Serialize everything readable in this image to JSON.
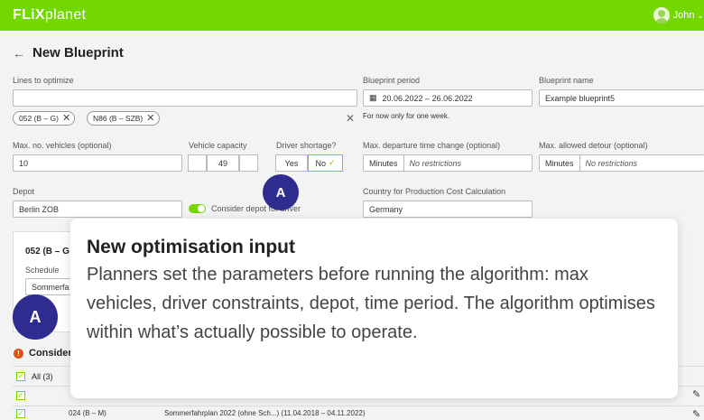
{
  "header": {
    "brand_bold": "FLiX",
    "brand_light": "planet",
    "user_name": "John",
    "colors": {
      "brand": "#73d700",
      "badge": "#2e2c8e",
      "warning": "#e2520e"
    }
  },
  "page": {
    "back_icon": "arrow-left-icon",
    "title": "New Blueprint"
  },
  "form": {
    "lines_label": "Lines to optimize",
    "lines_value": "",
    "chips": [
      "052 (B – G)",
      "N86 (B – SZB)"
    ],
    "period_label": "Blueprint period",
    "period_value": "20.06.2022 – 26.06.2022",
    "period_hint": "For now only for one week.",
    "name_label": "Blueprint name",
    "name_value": "Example blueprint5",
    "max_vehicles_label": "Max. no. vehicles (optional)",
    "max_vehicles_value": "10",
    "capacity_label": "Vehicle capacity",
    "capacity_value": "49",
    "driver_shortage_label": "Driver shortage?",
    "yes_label": "Yes",
    "no_label": "No",
    "departure_change_label": "Max. departure time change (optional)",
    "minutes_label": "Minutes",
    "no_restrictions": "No restrictions",
    "detour_label": "Max. allowed detour (optional)",
    "depot_label": "Depot",
    "depot_value": "Berlin ZOB",
    "consider_depot_label": "Consider depot for driver",
    "country_label": "Country for Production Cost Calculation",
    "country_value": "Germany"
  },
  "card": {
    "line": "052 (B – G",
    "schedule_label": "Schedule",
    "schedule_value": "Sommerfa"
  },
  "list": {
    "consider_label": "Consider",
    "all_label": "All (3)",
    "row_partial_1": "A",
    "row_partial_2": "024 (B – M)",
    "row_partial_3": "Sommerfahrplan 2022 (ohne Sch...) (11.04.2018 – 04.11.2022)"
  },
  "badges": {
    "letter": "A"
  },
  "tooltip": {
    "title": "New optimisation input",
    "body": "Planners set the parameters before running the algorithm: max vehicles, driver constraints, depot, time period. The algorithm optimises within what’s actually possible to operate."
  }
}
